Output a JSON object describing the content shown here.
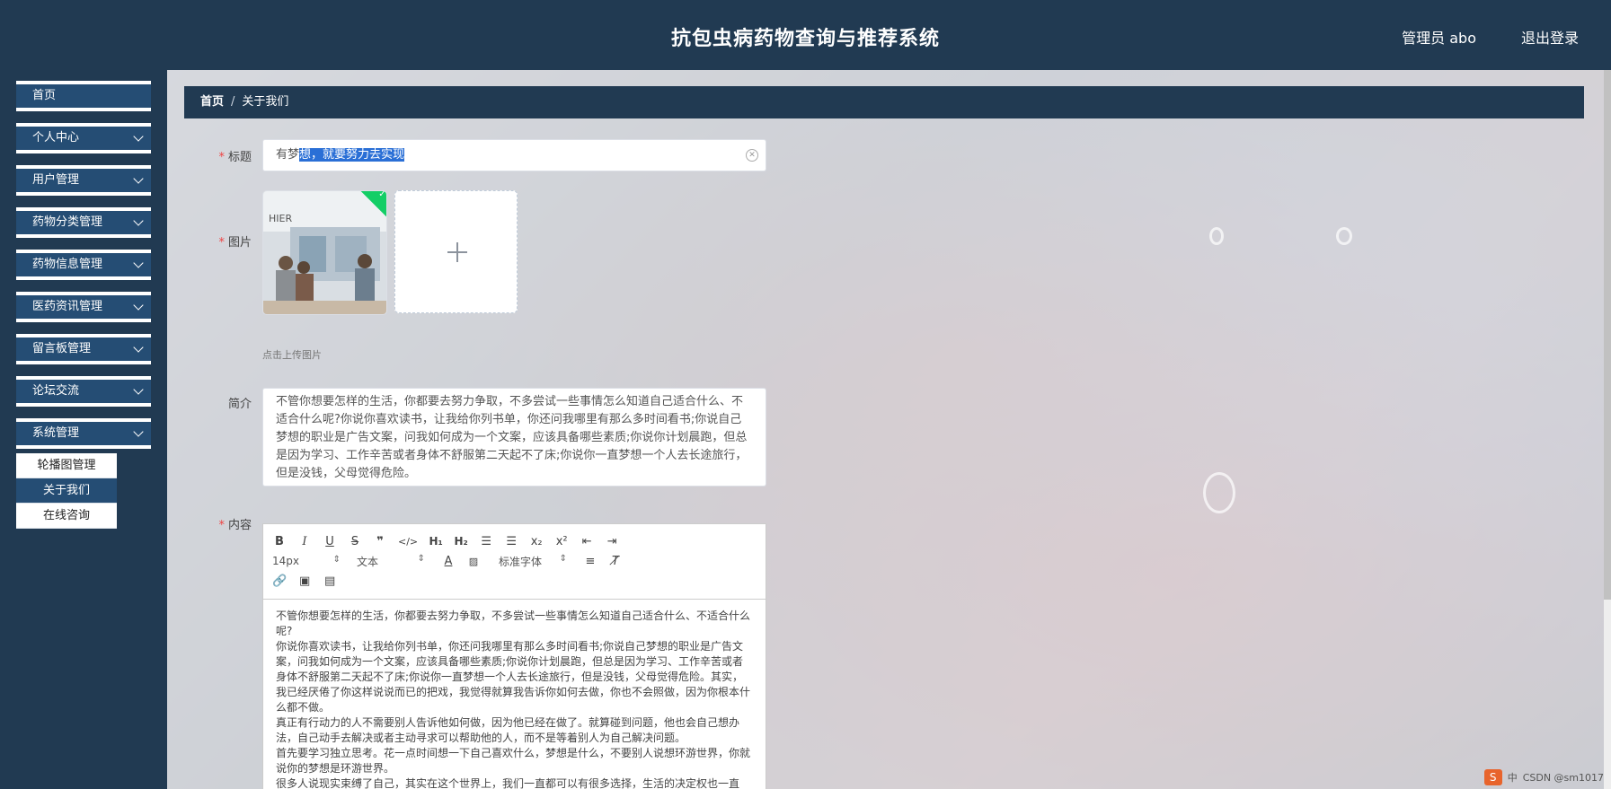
{
  "header": {
    "title": "抗包虫病药物查询与推荐系统",
    "user": "管理员 abo",
    "logout": "退出登录"
  },
  "sidebar": {
    "items": [
      {
        "label": "首页"
      },
      {
        "label": "个人中心"
      },
      {
        "label": "用户管理"
      },
      {
        "label": "药物分类管理"
      },
      {
        "label": "药物信息管理"
      },
      {
        "label": "医药资讯管理"
      },
      {
        "label": "留言板管理"
      },
      {
        "label": "论坛交流"
      },
      {
        "label": "系统管理"
      }
    ],
    "submenu": [
      {
        "label": "轮播图管理"
      },
      {
        "label": "关于我们"
      },
      {
        "label": "在线咨询"
      }
    ]
  },
  "breadcrumb": {
    "home": "首页",
    "separator": "/",
    "current": "关于我们"
  },
  "form": {
    "title_label": "标题",
    "title_value_prefix": "有梦",
    "title_value_selected": "想，就要努力去实现",
    "image_label": "图片",
    "upload_tip": "点击上传图片",
    "intro_label": "简介",
    "intro_value": "不管你想要怎样的生活，你都要去努力争取，不多尝试一些事情怎么知道自己适合什么、不适合什么呢?你说你喜欢读书，让我给你列书单，你还问我哪里有那么多时间看书;你说自己梦想的职业是广告文案，问我如何成为一个文案，应该具备哪些素质;你说你计划晨跑，但总是因为学习、工作辛苦或者身体不舒服第二天起不了床;你说你一直梦想一个人去长途旅行，但是没钱，父母觉得危险。",
    "content_label": "内容"
  },
  "editor": {
    "font_size": "14px",
    "block_type": "文本",
    "font_family": "标准字体",
    "paragraphs": [
      "不管你想要怎样的生活，你都要去努力争取，不多尝试一些事情怎么知道自己适合什么、不适合什么呢?",
      "你说你喜欢读书，让我给你列书单，你还问我哪里有那么多时间看书;你说自己梦想的职业是广告文案，问我如何成为一个文案，应该具备哪些素质;你说你计划晨跑，但总是因为学习、工作辛苦或者身体不舒服第二天起不了床;你说你一直梦想一个人去长途旅行，但是没钱，父母觉得危险。其实，我已经厌倦了你这样说说而已的把戏，我觉得就算我告诉你如何去做，你也不会照做，因为你根本什么都不做。",
      "真正有行动力的人不需要别人告诉他如何做，因为他已经在做了。就算碰到问题，他也会自己想办法，自己动手去解决或者主动寻求可以帮助他的人，而不是等着别人为自己解决问题。",
      "首先要学习独立思考。花一点时间想一下自己喜欢什么，梦想是什么，不要别人说想环游世界，你就说你的梦想是环游世界。",
      "很多人说现实束缚了自己，其实在这个世界上，我们一直都可以有很多选择，生活的决定权也一直"
    ]
  },
  "tray": {
    "ime": "中",
    "watermark": "CSDN @sm1017"
  }
}
